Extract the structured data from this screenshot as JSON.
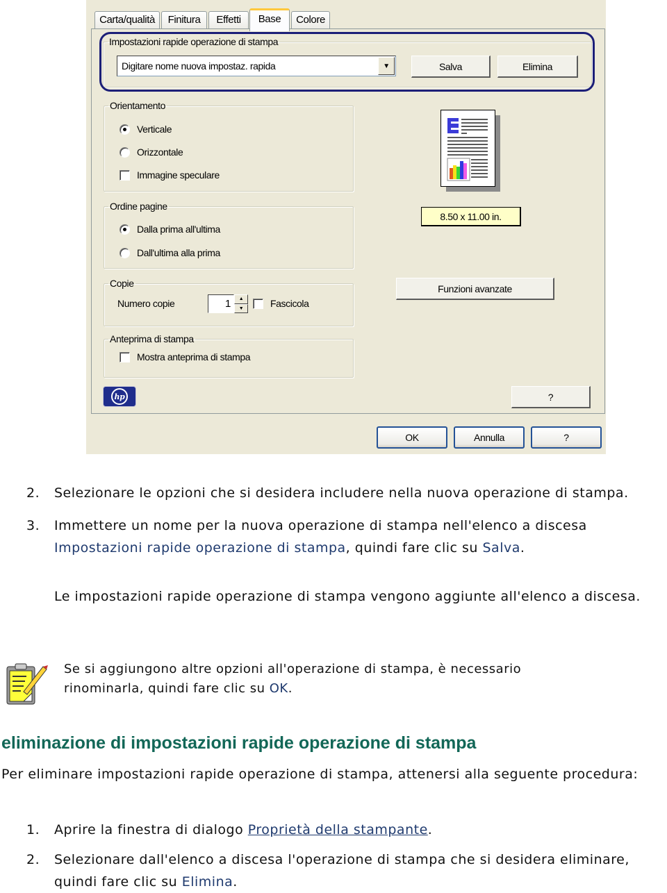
{
  "dialog": {
    "tabs": [
      {
        "label": "Carta/qualità",
        "active": false
      },
      {
        "label": "Finitura",
        "active": false
      },
      {
        "label": "Effetti",
        "active": false
      },
      {
        "label": "Base",
        "active": true
      },
      {
        "label": "Colore",
        "active": false
      }
    ],
    "quick_settings": {
      "legend": "Impostazioni rapide operazione di stampa",
      "combo_value": "Digitare nome nuova impostaz. rapida",
      "save_label": "Salva",
      "delete_label": "Elimina"
    },
    "orientation": {
      "legend": "Orientamento",
      "options": [
        {
          "label": "Verticale",
          "type": "radio",
          "selected": true
        },
        {
          "label": "Orizzontale",
          "type": "radio",
          "selected": false
        },
        {
          "label": "Immagine speculare",
          "type": "checkbox",
          "selected": false
        }
      ]
    },
    "page_order": {
      "legend": "Ordine pagine",
      "options": [
        {
          "label": "Dalla prima all'ultima",
          "selected": true
        },
        {
          "label": "Dall'ultima alla prima",
          "selected": false
        }
      ]
    },
    "copies": {
      "legend": "Copie",
      "count_label": "Numero copie",
      "count_value": "1",
      "collate_label": "Fascicola",
      "collate_checked": false
    },
    "print_preview": {
      "legend": "Anteprima di stampa",
      "show_label": "Mostra anteprima di stampa",
      "checked": false
    },
    "paper_size": "8.50 x 11.00 in.",
    "advanced_label": "Funzioni avanzate",
    "help_inner_label": "?",
    "logo_text": "hp",
    "footer": {
      "ok": "OK",
      "cancel": "Annulla",
      "help": "?"
    }
  },
  "doc": {
    "step2": {
      "num": "2.",
      "text": "Selezionare le opzioni che si desidera includere nella nuova operazione di stampa."
    },
    "step3": {
      "num": "3.",
      "text_a": "Immettere un nome per la nuova operazione di stampa nell'elenco a discesa",
      "link_a": "Impostazioni rapide operazione di stampa",
      "text_b": ", quindi fare clic su ",
      "link_b": "Salva",
      "text_c": ".",
      "result": "Le impostazioni rapide operazione di stampa vengono aggiunte all'elenco a discesa."
    },
    "note": {
      "text_a": "Se si aggiungono altre opzioni all'operazione di stampa, è necessario rinominarla, quindi fare clic su ",
      "link": "OK",
      "text_b": "."
    },
    "heading": "eliminazione di impostazioni rapide operazione di stampa",
    "intro": "Per eliminare impostazioni rapide operazione di stampa, attenersi alla seguente procedura:",
    "del_step1": {
      "num": "1.",
      "text_a": "Aprire la finestra di dialogo ",
      "link": "Proprietà della stampante",
      "text_b": "."
    },
    "del_step2": {
      "num": "2.",
      "text_a": "Selezionare dall'elenco a discesa l'operazione di stampa che si desidera eliminare, quindi fare clic su ",
      "link": "Elimina",
      "text_b": "."
    }
  }
}
